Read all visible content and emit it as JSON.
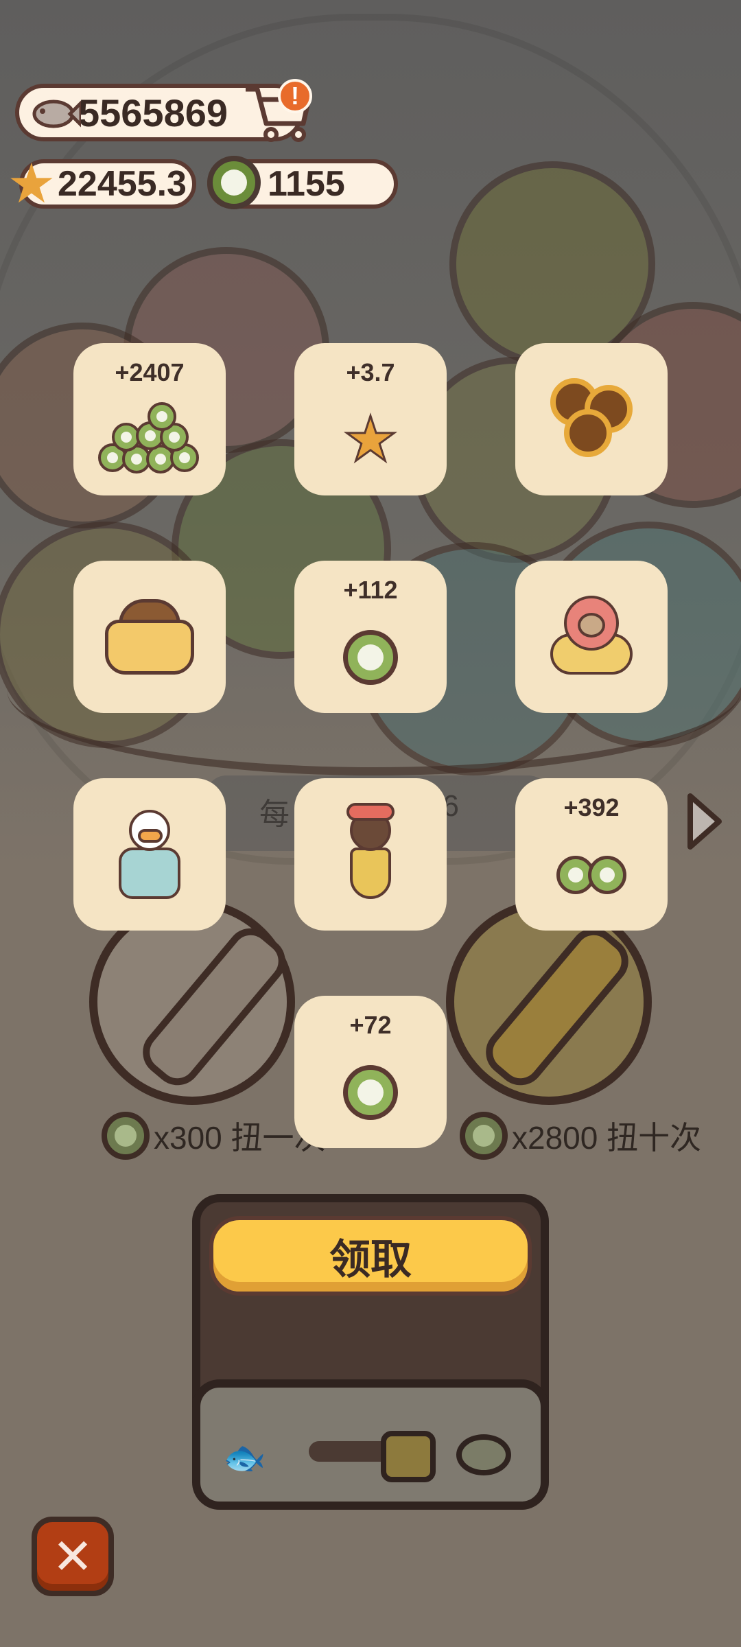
{
  "hud": {
    "fish_count": "5565869",
    "star_count": "22455.3",
    "coin_count": "1155",
    "cart_badge": "!"
  },
  "rewards": [
    {
      "amount": "+2407",
      "icon": "coin-pile-icon"
    },
    {
      "amount": "+3.7",
      "icon": "star-icon"
    },
    {
      "amount": "",
      "icon": "sunflower-icon"
    },
    {
      "amount": "",
      "icon": "sack-icon"
    },
    {
      "amount": "+112",
      "icon": "coin-icon"
    },
    {
      "amount": "",
      "icon": "starfish-cat-icon"
    },
    {
      "amount": "",
      "icon": "duck-character-icon"
    },
    {
      "amount": "",
      "icon": "dog-character-icon"
    },
    {
      "amount": "+392",
      "icon": "two-coins-icon"
    },
    {
      "amount": "+72",
      "icon": "coin-icon"
    }
  ],
  "background_label": {
    "left": "每",
    "right": "16"
  },
  "spin": {
    "once_label": "x300 扭一次",
    "ten_label": "x2800 扭十次"
  },
  "claim_button": "领取",
  "close_button": "✕",
  "colors": {
    "card_bg": "#f5e4c4",
    "claim_yellow": "#fcc94a",
    "close_red": "#b23e14",
    "coin_green": "#90b35a",
    "star_orange": "#e9a33c"
  }
}
